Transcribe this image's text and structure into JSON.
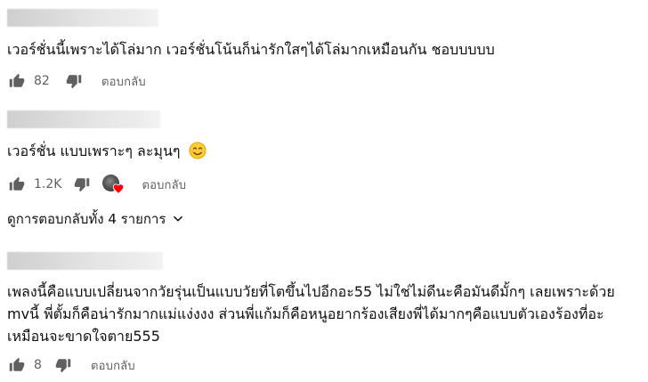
{
  "comments": [
    {
      "text": "เวอร์ชั่นนี้เพราะได้โล่มาก เวอร์ชั่นโน้นก็น่ารักใสๆได้โล่มากเหมือนกัน ชอบบบบบ",
      "likes": "82",
      "reply_label": "ตอบกลับ"
    },
    {
      "text": "เวอร์ชั่น แบบเพราะๆ ละมุนๆ",
      "emoji": "smiling-face-emoji",
      "likes": "1.2K",
      "reply_label": "ตอบกลับ",
      "creator_heart": true,
      "view_replies_label": "ดูการตอบกลับทั้ง 4 รายการ"
    },
    {
      "text": "เพลงนี้คือแบบเปลี่ยนจากวัยรุ่นเป็นแบบวัยที่โตขึ้นไปอีกอะ55 ไม่ใช่ไม่ดีนะคือมันดีมั้กๆ เลยเพราะด้วย mvนี้ พี่ตั้มก็คือน่ารักมากแม่แง่งงง ส่วนพี่แก้มก็คือหนูอยากร้องเสียงพี่ได้มากๆคือแบบตัวเองร้องที่อะ เหมือนจะขาดใจตาย555",
      "likes": "8",
      "reply_label": "ตอบกลับ"
    }
  ],
  "icons": {
    "like": "thumbs-up-icon",
    "dislike": "thumbs-down-icon",
    "expand": "chevron-down-icon",
    "heart": "creator-heart-icon"
  },
  "colors": {
    "text": "#0f0f0f",
    "secondary": "#606060",
    "heart": "#ff0000"
  }
}
